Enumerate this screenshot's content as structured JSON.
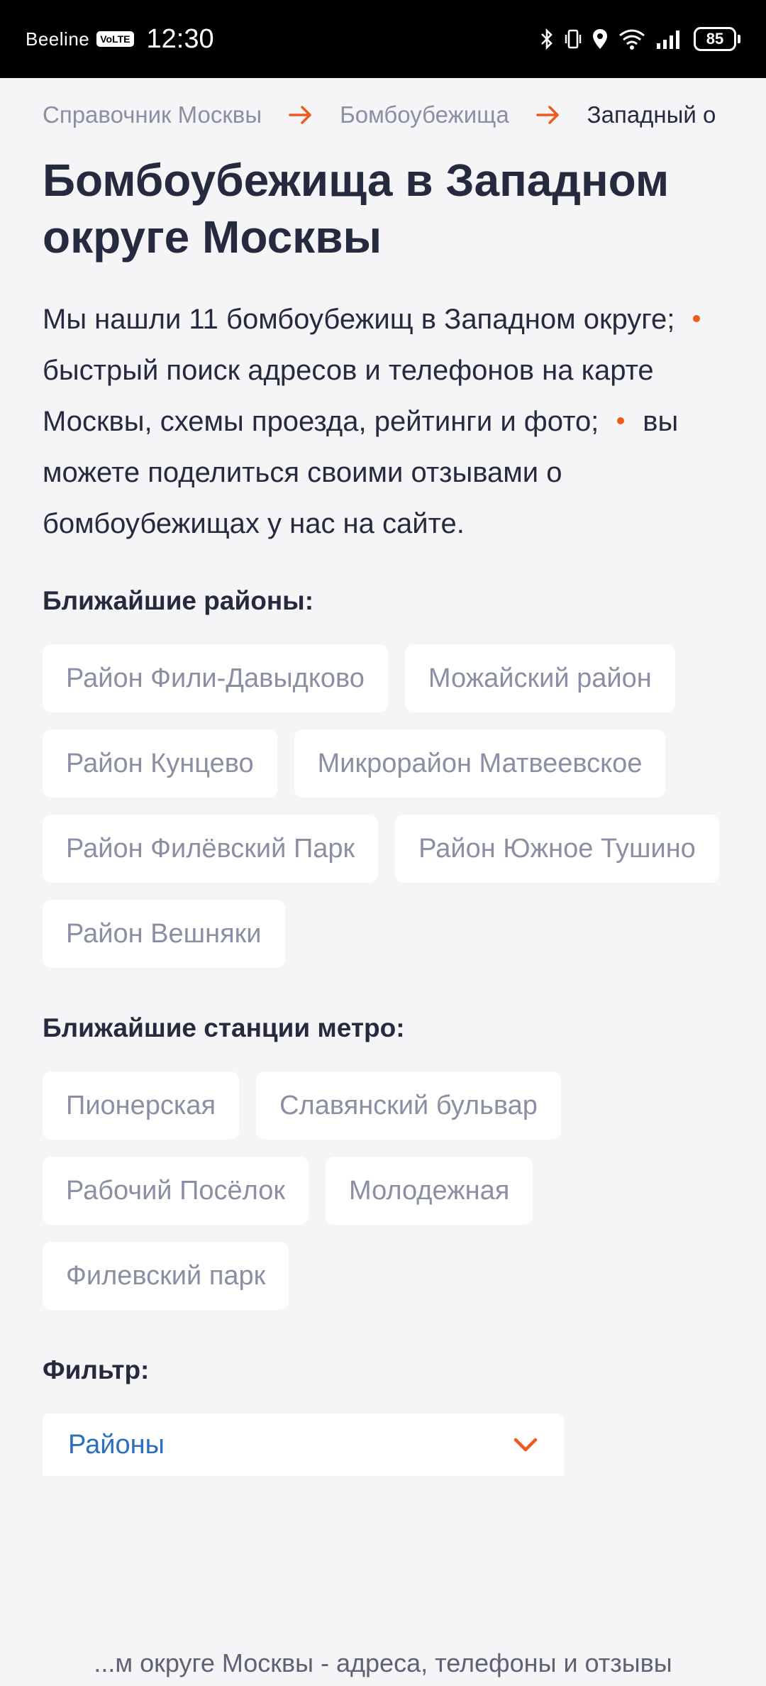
{
  "status_bar": {
    "carrier": "Beeline",
    "volte": "VoLTE",
    "time": "12:30",
    "battery": "85"
  },
  "breadcrumb": {
    "items": [
      "Справочник Москвы",
      "Бомбоубежища",
      "Западный о"
    ]
  },
  "page": {
    "title": "Бомбоубежища в Западном округе Москвы",
    "description": {
      "part1": "Мы нашли 11 бомбоубежищ в Западном округе;",
      "part2": "быстрый поиск адресов и телефонов на карте Москвы, схемы проезда, рейтинги и фото;",
      "part3": "вы можете поделиться своими отзывами о бомбоубежищах у нас на сайте."
    }
  },
  "districts": {
    "heading": "Ближайшие районы:",
    "items": [
      "Район Фили-Давыдково",
      "Можайский район",
      "Район Кунцево",
      "Микрорайон Матвеевское",
      "Район Филёвский Парк",
      "Район Южное Тушино",
      "Район Вешняки"
    ]
  },
  "metro": {
    "heading": "Ближайшие станции метро:",
    "items": [
      "Пионерская",
      "Славянский бульвар",
      "Рабочий Посёлок",
      "Молодежная",
      "Филевский парк"
    ]
  },
  "filter": {
    "heading": "Фильтр:",
    "selected": "Районы"
  },
  "bottom_bar": {
    "text": "...м округе Москвы - адреса, телефоны и отзывы"
  },
  "colors": {
    "accent": "#ec5a1f",
    "link": "#2a6fc0",
    "background": "#f5f5f8",
    "text": "#262a3f",
    "muted": "#8a8fa3"
  }
}
